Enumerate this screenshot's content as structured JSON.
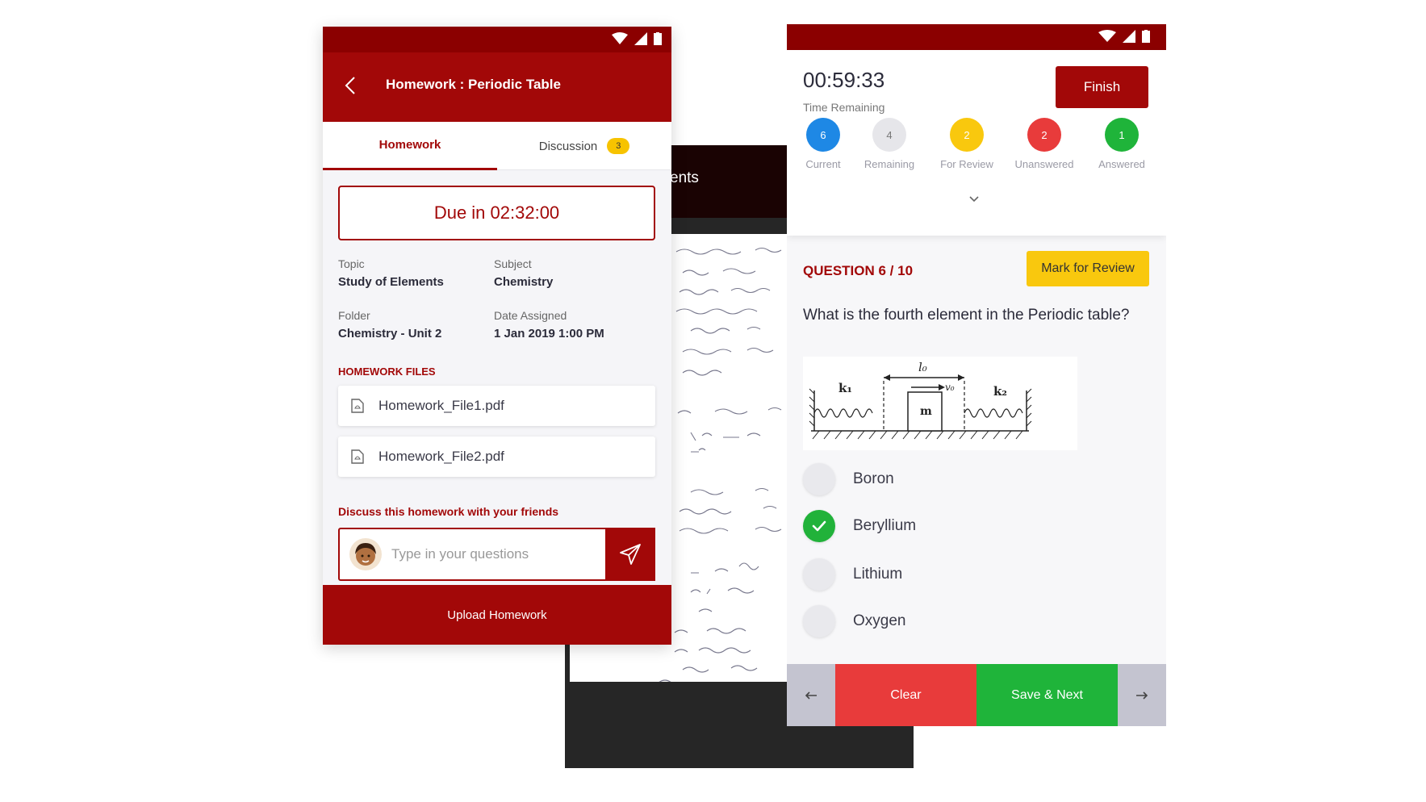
{
  "colors": {
    "brand": "#a20808",
    "status_bar": "#8b0000",
    "clear": "#e83b3b",
    "save": "#1fb43a",
    "review": "#f9c80e",
    "answered_check": "#21b23a"
  },
  "homework_screen": {
    "title": "Homework : Periodic Table",
    "tabs": [
      {
        "label": "Homework",
        "active": true
      },
      {
        "label": "Discussion",
        "badge": "3"
      }
    ],
    "due": "Due in 02:32:00",
    "details": {
      "topic_label": "Topic",
      "topic_value": "Study of Elements",
      "subject_label": "Subject",
      "subject_value": "Chemistry",
      "folder_label": "Folder",
      "folder_value": "Chemistry - Unit 2",
      "date_label": "Date Assigned",
      "date_value": "1 Jan 2019 1:00 PM"
    },
    "files_heading": "HOMEWORK FILES",
    "files": [
      "Homework_File1.pdf",
      "Homework_File2.pdf"
    ],
    "discuss_heading": "Discuss this homework with your friends",
    "question_placeholder": "Type in your questions",
    "upload_label": "Upload Homework"
  },
  "background_screen": {
    "header_fragment": "ents"
  },
  "quiz_screen": {
    "timer": "00:59:33",
    "timer_label": "Time Remaining",
    "finish_label": "Finish",
    "stats": [
      {
        "value": "6",
        "label": "Current",
        "color": "#1e88e5"
      },
      {
        "value": "4",
        "label": "Remaining",
        "color": "#e6e6ea"
      },
      {
        "value": "2",
        "label": "For Review",
        "color": "#f9c80e"
      },
      {
        "value": "2",
        "label": "Unanswered",
        "color": "#e83b3b"
      },
      {
        "value": "1",
        "label": "Answered",
        "color": "#1fb43a"
      }
    ],
    "question_number": "QUESTION 6 / 10",
    "mark_review_label": "Mark for Review",
    "question_text": "What is the fourth element in the Periodic table?",
    "figure_labels": {
      "length": "l₀",
      "velocity": "v₀",
      "spring1": "k₁",
      "spring2": "k₂",
      "mass": "m"
    },
    "options": [
      {
        "label": "Boron",
        "selected": false
      },
      {
        "label": "Beryllium",
        "selected": true
      },
      {
        "label": "Lithium",
        "selected": false
      },
      {
        "label": "Oxygen",
        "selected": false
      }
    ],
    "clear_label": "Clear",
    "save_next_label": "Save & Next"
  }
}
